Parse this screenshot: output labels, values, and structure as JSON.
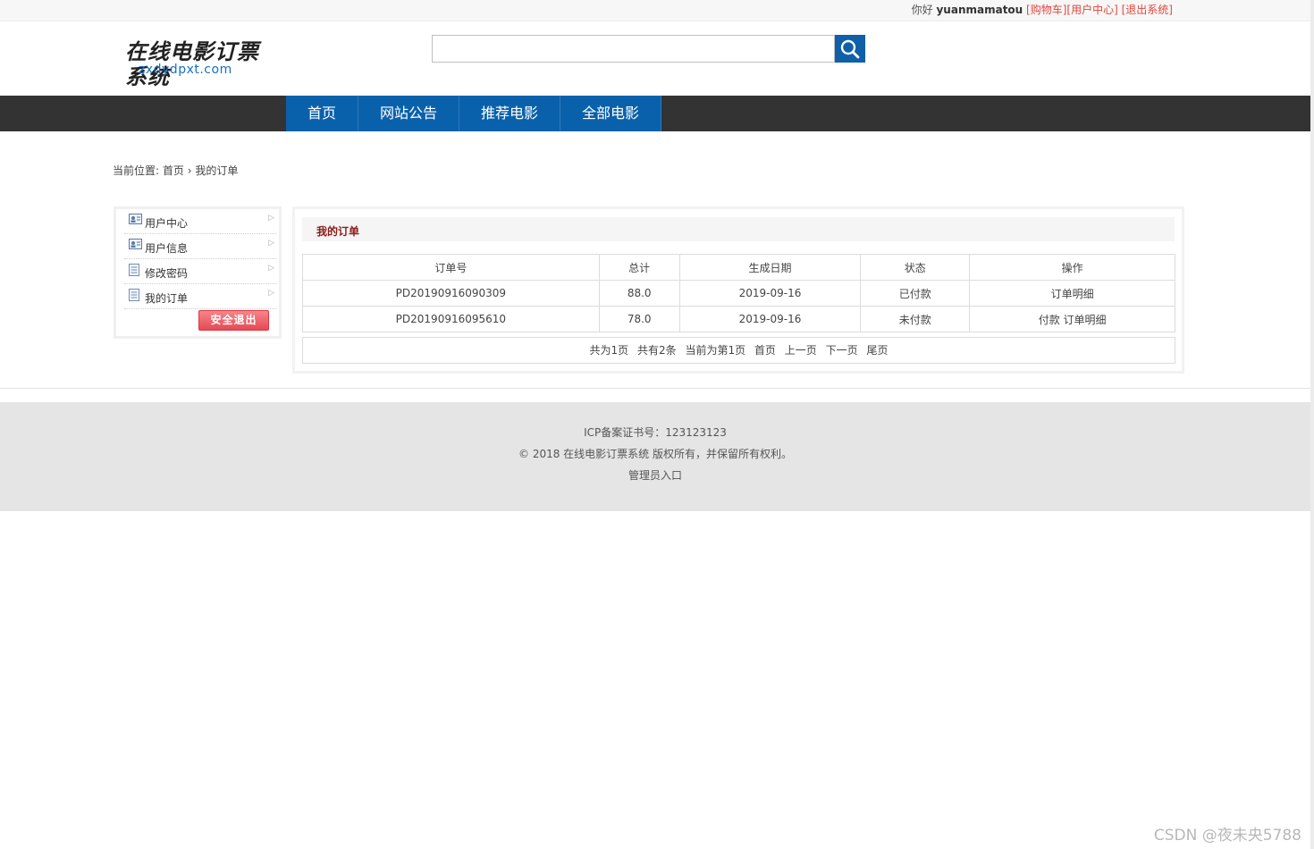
{
  "topbar": {
    "greeting": "你好",
    "username": "yuanmamatou",
    "links": [
      "[购物车]",
      "[用户中心]",
      "[退出系统]"
    ]
  },
  "header": {
    "logo_cn": "在线电影订票系统",
    "logo_en": "zxdydpxt.com",
    "search_value": "",
    "search_icon": "search-icon"
  },
  "nav": {
    "items": [
      "首页",
      "网站公告",
      "推荐电影",
      "全部电影"
    ]
  },
  "breadcrumb": {
    "prefix": "当前位置:",
    "home": "首页",
    "sep": "›",
    "current": "我的订单"
  },
  "sidebar": {
    "items": [
      {
        "label": "用户中心",
        "icon": "user-card-icon"
      },
      {
        "label": "用户信息",
        "icon": "user-card-icon"
      },
      {
        "label": "修改密码",
        "icon": "document-icon"
      },
      {
        "label": "我的订单",
        "icon": "document-icon"
      }
    ],
    "logout_label": "安全退出"
  },
  "main": {
    "title": "我的订单",
    "columns": [
      "订单号",
      "总计",
      "生成日期",
      "状态",
      "操作"
    ],
    "rows": [
      {
        "order_no": "PD20190916090309",
        "total": "88.0",
        "date": "2019-09-16",
        "status": "已付款",
        "ops": [
          "订单明细"
        ]
      },
      {
        "order_no": "PD20190916095610",
        "total": "78.0",
        "date": "2019-09-16",
        "status": "未付款",
        "ops": [
          "付款",
          "订单明细"
        ]
      }
    ],
    "pager": {
      "total_pages": "共为1页",
      "total_items": "共有2条",
      "current": "当前为第1页",
      "first": "首页",
      "prev": "上一页",
      "next": "下一页",
      "last": "尾页"
    }
  },
  "footer": {
    "icp": "ICP备案证书号：123123123",
    "copyright": "© 2018 在线电影订票系统 版权所有，并保留所有权利。",
    "admin": "管理员入口"
  },
  "watermark": "CSDN @夜未央5788",
  "colors": {
    "nav_bg": "#333333",
    "nav_item": "#0a61ab",
    "link_red": "#e0473e",
    "title_red": "#8b1a1a",
    "footer_bg": "#e5e5e5"
  }
}
